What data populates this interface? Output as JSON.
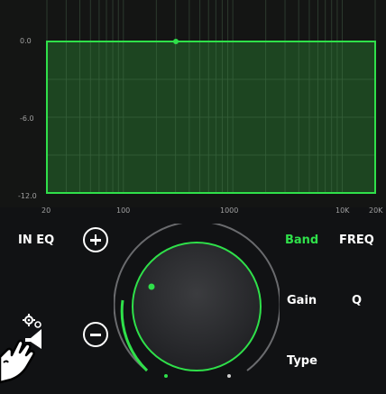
{
  "eq_graph": {
    "y_labels": [
      "0.0",
      "-6.0",
      "-12.0"
    ],
    "x_labels": [
      "20",
      "100",
      "1000",
      "10K",
      "20K"
    ],
    "line_color": "#2fe04a",
    "fill_color": "#1f4a22"
  },
  "controls": {
    "in_eq_label": "IN EQ",
    "band_label": "Band",
    "freq_label": "FREQ",
    "gain_label": "Gain",
    "q_label": "Q",
    "type_label": "Type",
    "accent": "#2fe04a"
  },
  "icons": {
    "add": "plus-circle-icon",
    "remove": "minus-circle-icon",
    "speaker_settings": "speaker-gear-icon",
    "hand": "hand-pointer-icon"
  }
}
